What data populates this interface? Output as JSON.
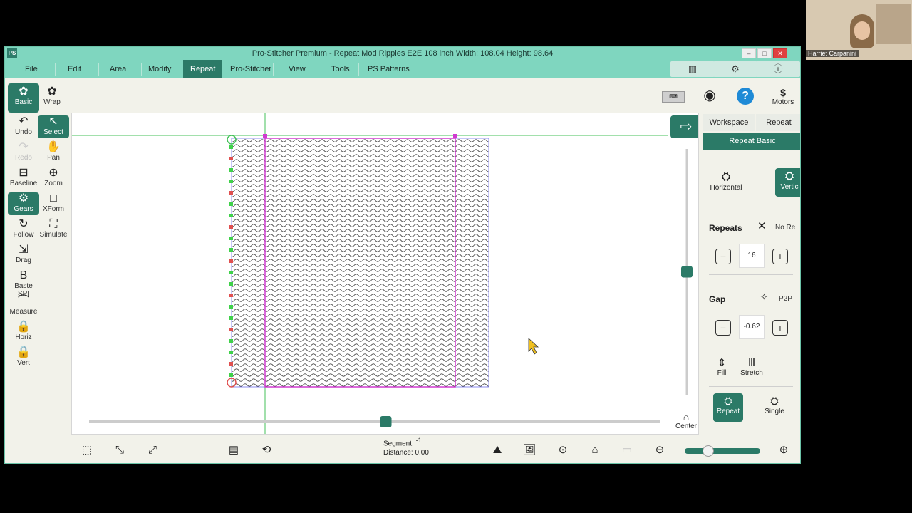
{
  "window": {
    "app_icon": "PS",
    "title": "Pro-Stitcher Premium   -   Repeat Mod Ripples E2E 108 inch   Width: 108.04   Height: 98.64",
    "min": "–",
    "max": "□",
    "close": "✕"
  },
  "menu": {
    "items": [
      "File",
      "Edit",
      "Area",
      "Modify",
      "Repeat",
      "Pro-Stitcher",
      "View",
      "Tools",
      "PS Patterns"
    ],
    "active": "Repeat"
  },
  "top_right_icons": [
    "book-icon",
    "gear-icon",
    "info-icon"
  ],
  "toolbar_row": {
    "basic": "Basic",
    "wrap": "Wrap",
    "right_icons": [
      "keyboard-icon",
      "wifi-icon",
      "help-icon"
    ],
    "motors": "Motors"
  },
  "left_tools": [
    {
      "label": "Undo",
      "icon": "undo-icon",
      "glyph": "↶",
      "selected": false,
      "dim": false
    },
    {
      "label": "Select",
      "icon": "select-icon",
      "glyph": "↖",
      "selected": true,
      "dim": false
    },
    {
      "label": "Redo",
      "icon": "redo-icon",
      "glyph": "↷",
      "selected": false,
      "dim": true
    },
    {
      "label": "Pan",
      "icon": "hand-icon",
      "glyph": "✋",
      "selected": false,
      "dim": false
    },
    {
      "label": "Baseline",
      "icon": "baseline-icon",
      "glyph": "⊟",
      "selected": false,
      "dim": false
    },
    {
      "label": "Zoom",
      "icon": "zoom-icon",
      "glyph": "⊕",
      "selected": false,
      "dim": false
    },
    {
      "label": "Gears",
      "icon": "gears-icon",
      "glyph": "⚙",
      "selected": true,
      "dim": false
    },
    {
      "label": "XForm",
      "icon": "xform-icon",
      "glyph": "□",
      "selected": false,
      "dim": false
    },
    {
      "label": "Follow",
      "icon": "follow-icon",
      "glyph": "↻",
      "selected": false,
      "dim": false
    },
    {
      "label": "Simulate",
      "icon": "simulate-icon",
      "glyph": "⛶",
      "selected": false,
      "dim": false
    },
    {
      "label": "Drag",
      "icon": "drag-icon",
      "glyph": "⇲",
      "selected": false,
      "dim": false
    },
    {
      "label": "Baste SPI",
      "icon": "baste-icon",
      "glyph": "B",
      "selected": false,
      "dim": false
    },
    {
      "label": "Measure",
      "icon": "measure-icon",
      "glyph": "⌒",
      "selected": false,
      "dim": false
    },
    {
      "label": "Horiz",
      "icon": "lock-horiz-icon",
      "glyph": "🔒",
      "selected": false,
      "dim": false
    },
    {
      "label": "Vert",
      "icon": "lock-vert-icon",
      "glyph": "🔒",
      "selected": false,
      "dim": false
    }
  ],
  "right_panel": {
    "tabs": [
      "Workspace",
      "Repeat"
    ],
    "subtab": "Repeat Basic",
    "horizontal": "Horizontal",
    "vertical": "Vertic",
    "repeats_label": "Repeats",
    "no_repeat": "No Re",
    "repeats_value": "16",
    "gap_label": "Gap",
    "p2p": "P2P",
    "gap_value": "-0.62",
    "fill": "Fill",
    "stretch": "Stretch",
    "repeat": "Repeat",
    "single": "Single"
  },
  "canvas": {
    "center": "Center",
    "vertical_slider_level": 0.5,
    "horizontal_slider_level": 0.52
  },
  "status": {
    "segment_label": "Segment:",
    "segment_value": "-1",
    "distance_label": "Distance:",
    "distance_value": "0.00",
    "zoom_level": 0.3
  },
  "webcam": {
    "name": "Harriet Carpanini"
  },
  "colors": {
    "accent": "#2b7a67",
    "menubar": "#7fd6bf",
    "pattern_border": "#d03ad0",
    "guide_green": "#45c25a"
  }
}
